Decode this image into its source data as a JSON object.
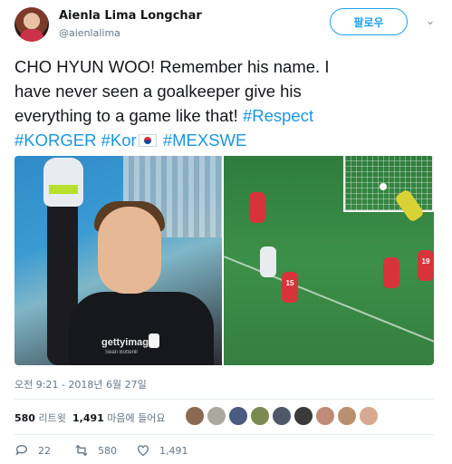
{
  "author": {
    "display_name": "Aienla Lima Longchar",
    "handle": "@aienlalima",
    "follow_label": "팔로우"
  },
  "tweet": {
    "text_line1": "CHO HYUN WOO! Remember his name. I",
    "text_line2": "have never seen a goalkeeper give his",
    "text_line3a": "everything to a game like that! ",
    "hashtag_respect": "#Respect",
    "hashtag_korger": "#KORGER",
    "hashtag_kor": "#Kor",
    "hashtag_mexswe": "#MEXSWE",
    "flag_icon": "south-korea-flag-icon"
  },
  "media": {
    "watermark": "gettyimages",
    "watermark_credit": "Sean Botterill",
    "jersey_numbers": [
      "15",
      "19"
    ]
  },
  "timestamp": "오전 9:21 - 2018년 6월 27일",
  "stats": {
    "retweets_count": "580",
    "retweets_label": "리트윗",
    "likes_count": "1,491",
    "likes_label": "마음에 들어요"
  },
  "actions": {
    "reply_count": "22",
    "retweet_count": "580",
    "like_count": "1,491"
  },
  "colors": {
    "accent": "#1da1f2",
    "hashtag": "#1b95e0",
    "muted": "#657786"
  }
}
